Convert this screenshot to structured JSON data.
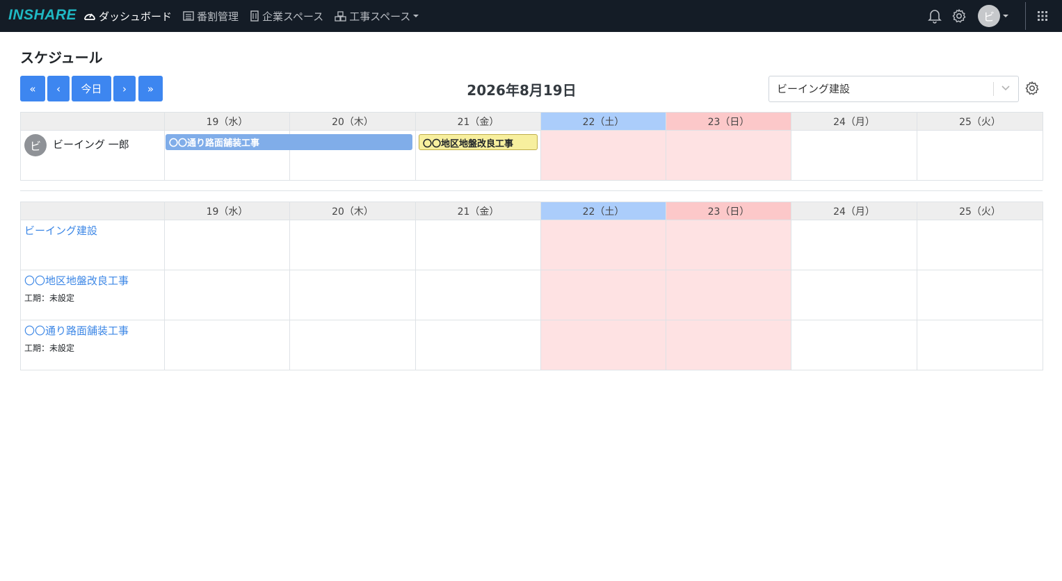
{
  "navbar": {
    "logo": "INSHARE",
    "links": [
      {
        "label": "ダッシュボード"
      },
      {
        "label": "番割管理"
      },
      {
        "label": "企業スペース"
      },
      {
        "label": "工事スペース"
      }
    ],
    "avatar": "ビ"
  },
  "page": {
    "title": "スケジュール",
    "date": "2026年8月19日",
    "buttons": {
      "first": "«",
      "prev": "‹",
      "today": "今日",
      "next": "›",
      "last": "»"
    },
    "company_select": "ビーイング建設"
  },
  "days": [
    {
      "label": "19（水）"
    },
    {
      "label": "20（木）"
    },
    {
      "label": "21（金）"
    },
    {
      "label": "22（土）"
    },
    {
      "label": "23（日）"
    },
    {
      "label": "24（月）"
    },
    {
      "label": "25（火）"
    }
  ],
  "user_schedule": {
    "user": {
      "avatar": "ビ",
      "name": "ビーイング 一郎"
    },
    "events": [
      {
        "title": "〇〇通り路面舗装工事",
        "color": "#80ade9"
      },
      {
        "title": "〇〇地区地盤改良工事",
        "color": "#f7ef9e"
      }
    ]
  },
  "projects": [
    {
      "name": "ビーイング建設",
      "sub": ""
    },
    {
      "name": "〇〇地区地盤改良工事",
      "sub": "工期：未設定"
    },
    {
      "name": "〇〇通り路面舗装工事",
      "sub": "工期：未設定"
    }
  ],
  "colors": {
    "primary": "#3d86f0",
    "saturday": "#abcdfb",
    "sunday": "#fcc8c9",
    "weekend_cell": "#fee2e3",
    "navbar": "#141c26"
  }
}
